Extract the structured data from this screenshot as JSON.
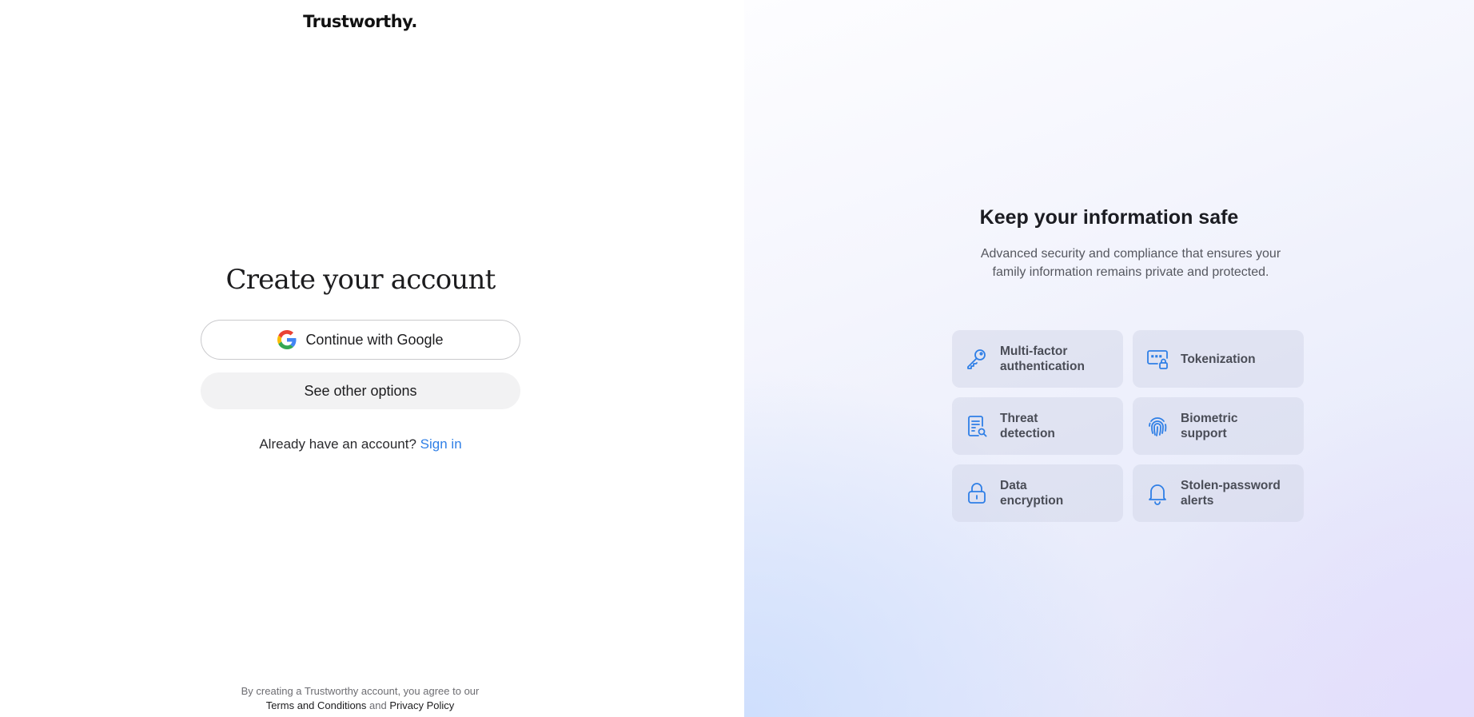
{
  "brand": {
    "logo_text": "Trustworthy."
  },
  "signup": {
    "title": "Create your account",
    "google_button_label": "Continue with Google",
    "other_options_label": "See other options",
    "signin_prompt": "Already have an account?",
    "signin_link": "Sign in"
  },
  "legal": {
    "line1": "By creating a Trustworthy account, you agree to our",
    "terms_link": "Terms and Conditions",
    "and_text": "and",
    "privacy_link": "Privacy Policy"
  },
  "promo": {
    "title": "Keep your information safe",
    "description": "Advanced security and compliance that ensures your family information remains private and protected.",
    "features": [
      {
        "label": "Multi-factor\nauthentication",
        "icon": "key-icon"
      },
      {
        "label": "Tokenization",
        "icon": "token-lock-icon"
      },
      {
        "label": "Threat\ndetection",
        "icon": "document-search-icon"
      },
      {
        "label": "Biometric\nsupport",
        "icon": "fingerprint-icon"
      },
      {
        "label": "Data\nencryption",
        "icon": "lock-icon"
      },
      {
        "label": "Stolen-password\nalerts",
        "icon": "bell-icon"
      }
    ]
  },
  "colors": {
    "accent": "#2f7fe6",
    "text": "#1c1c1e",
    "button_border": "#c9c9cc",
    "secondary_button_bg": "#f2f2f3"
  }
}
